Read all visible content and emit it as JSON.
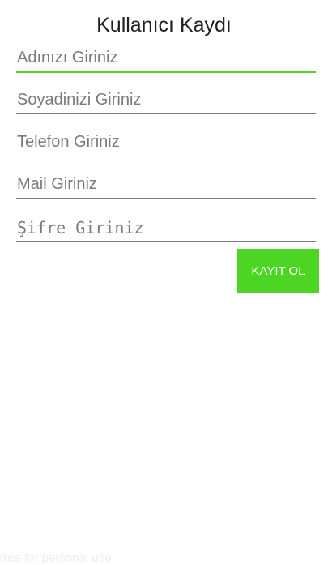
{
  "form": {
    "title": "Kullanıcı Kaydı",
    "fields": [
      {
        "placeholder": "Adınızı Giriniz"
      },
      {
        "placeholder": "Soyadinizi Giriniz"
      },
      {
        "placeholder": "Telefon Giriniz"
      },
      {
        "placeholder": "Mail Giriniz"
      },
      {
        "placeholder": "Şifre Giriniz"
      }
    ],
    "submit_label": "KAYIT OL"
  },
  "watermark": "free for personal use",
  "colors": {
    "accent": "#4cd623",
    "field_underline": "#7a7a7a",
    "placeholder_text": "#7b7b7b"
  }
}
